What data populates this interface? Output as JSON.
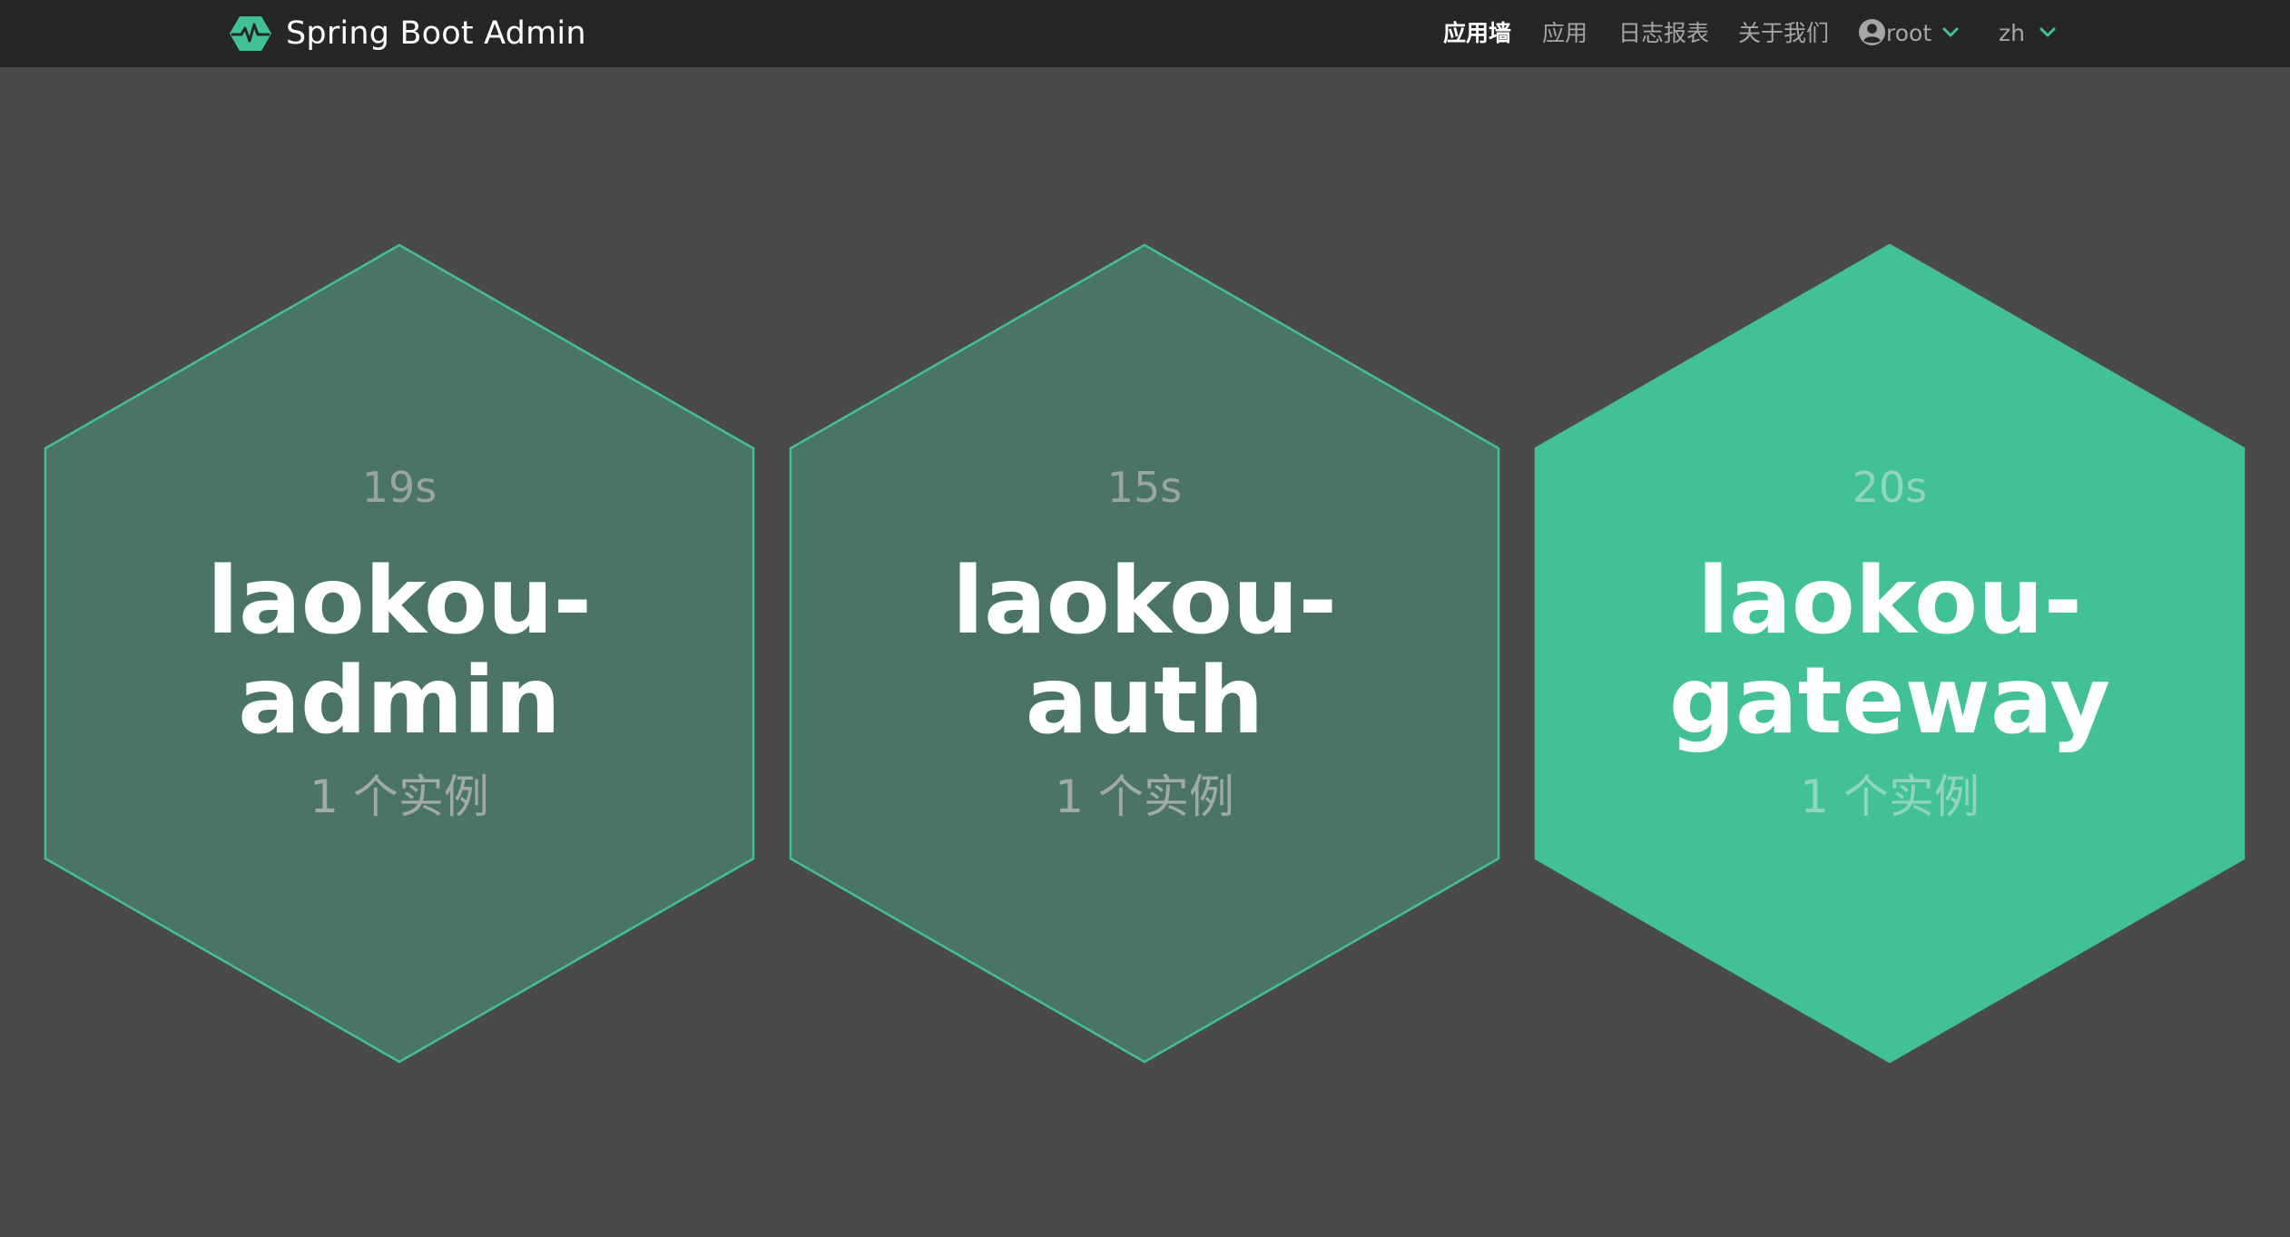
{
  "brand": {
    "title": "Spring Boot Admin",
    "logo_icon": "heartbeat-hexagon-icon",
    "accent": "#42c096"
  },
  "nav": {
    "items": [
      {
        "label": "应用墙",
        "active": true
      },
      {
        "label": "应用",
        "active": false
      },
      {
        "label": "日志报表",
        "active": false
      },
      {
        "label": "关于我们",
        "active": false
      }
    ],
    "user": {
      "label": "root",
      "icon": "user-circle-icon",
      "dropdown_icon": "chevron-down-icon"
    },
    "language": {
      "label": "zh",
      "dropdown_icon": "chevron-down-icon"
    }
  },
  "applications": [
    {
      "time": "19s",
      "name": "laokou-admin",
      "instances": "1 个实例",
      "status_color": "#4a7566",
      "highlighted": false
    },
    {
      "time": "15s",
      "name": "laokou-auth",
      "instances": "1 个实例",
      "status_color": "#4a7566",
      "highlighted": false
    },
    {
      "time": "20s",
      "name": "laokou-gateway",
      "instances": "1 个实例",
      "status_color": "#42c096",
      "highlighted": true
    }
  ],
  "colors": {
    "navbar_bg": "#262626",
    "page_bg": "#4a4a4a",
    "hex_border": "#42c096"
  }
}
